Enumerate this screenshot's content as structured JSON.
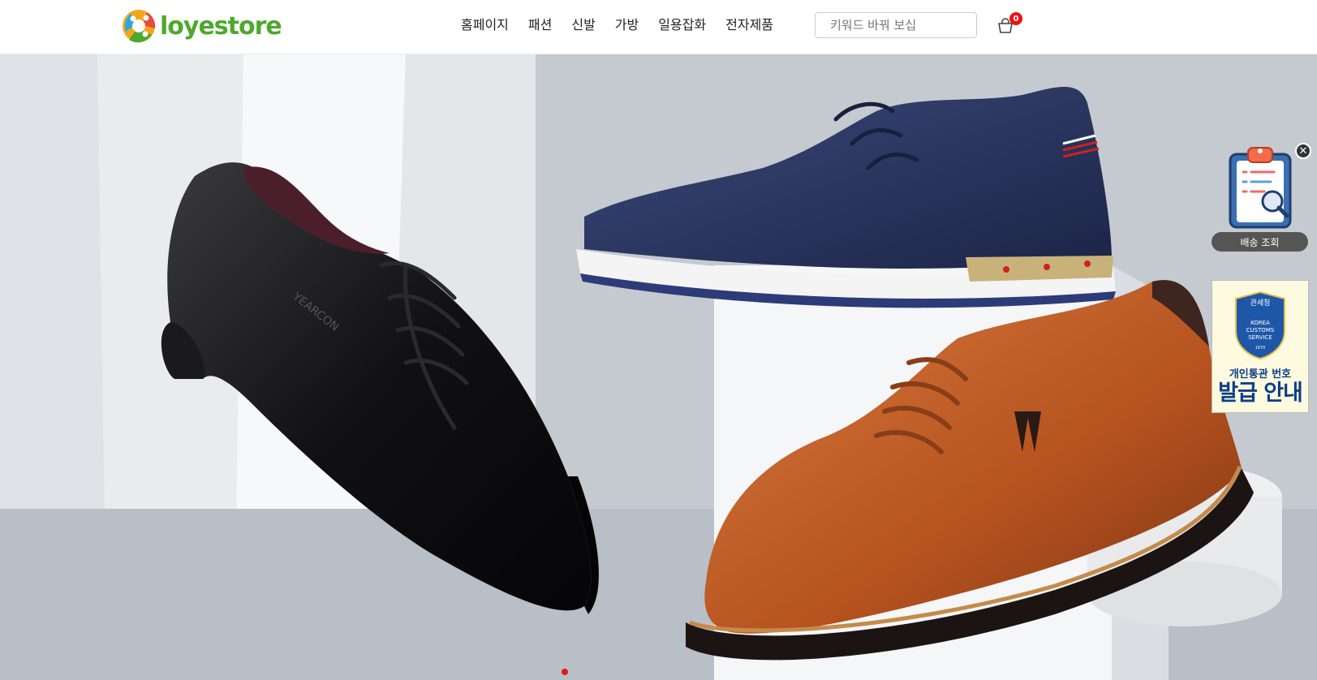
{
  "brand": {
    "name": "loyestore"
  },
  "nav": {
    "items": [
      {
        "label": "홈페이지"
      },
      {
        "label": "패션"
      },
      {
        "label": "신발"
      },
      {
        "label": "가방"
      },
      {
        "label": "일용잡화"
      },
      {
        "label": "전자제품"
      }
    ]
  },
  "search": {
    "placeholder": "키워드 바꿔 보십",
    "icon": "search-icon"
  },
  "cart": {
    "count": "0",
    "icon": "cart-icon"
  },
  "banner": {
    "shoe_brand_text": "YEARCON"
  },
  "widgets": {
    "tracking_label": "배송 조회",
    "close": "✕",
    "customs": {
      "agency": "관세청",
      "seal_lines": [
        "KOREA",
        "CUSTOMS",
        "SERVICE"
      ],
      "seal_year": "1970",
      "line1": "개인통관 번호",
      "line2": "발급 안내"
    }
  },
  "colors": {
    "accent": "#ee1111",
    "brand_green": "#4da82e",
    "customs_blue": "#0d3e8a"
  }
}
